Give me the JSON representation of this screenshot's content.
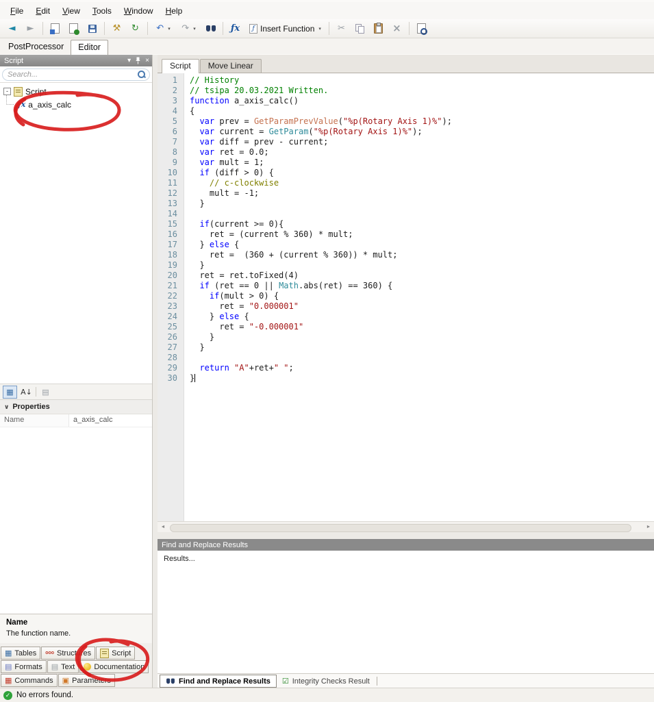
{
  "menu": {
    "items": [
      "File",
      "Edit",
      "View",
      "Tools",
      "Window",
      "Help"
    ]
  },
  "toolbar": {
    "insert_function_label": "Insert Function"
  },
  "workspace_tabs": {
    "postprocessor": "PostProcessor",
    "editor": "Editor"
  },
  "script_panel": {
    "title": "Script",
    "search_placeholder": "Search...",
    "tree": {
      "root_label": "Script",
      "child_label": "a_axis_calc"
    }
  },
  "properties_panel": {
    "header": "Properties",
    "name_label": "Name",
    "name_value": "a_axis_calc"
  },
  "description_box": {
    "title": "Name",
    "text": "The function name."
  },
  "left_tabs": {
    "tables": "Tables",
    "structures": "Structures",
    "script": "Script",
    "formats": "Formats",
    "text": "Text",
    "documentation": "Documentation",
    "commands": "Commands",
    "parameters": "Parameters"
  },
  "editor": {
    "tabs": [
      "Script",
      "Move Linear"
    ],
    "cursor_line": 30,
    "token_colors": {
      "k": "#0000ff",
      "c": "#008000",
      "o": "#808000",
      "s": "#a31515",
      "f": "#2e8b9a",
      "g": "#c4714f",
      "p": "#1c1c1c"
    },
    "code": [
      [
        [
          "c",
          "// History"
        ]
      ],
      [
        [
          "c",
          "// tsipa 20.03.2021 Written."
        ]
      ],
      [
        [
          "k",
          "function"
        ],
        [
          "p",
          " a_axis_calc()"
        ]
      ],
      [
        [
          "p",
          "{"
        ]
      ],
      [
        [
          "p",
          "  "
        ],
        [
          "k",
          "var"
        ],
        [
          "p",
          " prev = "
        ],
        [
          "g",
          "GetParamPrevValue"
        ],
        [
          "p",
          "("
        ],
        [
          "s",
          "\"%p(Rotary Axis 1)%\""
        ],
        [
          "p",
          ");"
        ]
      ],
      [
        [
          "p",
          "  "
        ],
        [
          "k",
          "var"
        ],
        [
          "p",
          " current = "
        ],
        [
          "f",
          "GetParam"
        ],
        [
          "p",
          "("
        ],
        [
          "s",
          "\"%p(Rotary Axis 1)%\""
        ],
        [
          "p",
          ");"
        ]
      ],
      [
        [
          "p",
          "  "
        ],
        [
          "k",
          "var"
        ],
        [
          "p",
          " diff = prev - current;"
        ]
      ],
      [
        [
          "p",
          "  "
        ],
        [
          "k",
          "var"
        ],
        [
          "p",
          " ret = 0.0;"
        ]
      ],
      [
        [
          "p",
          "  "
        ],
        [
          "k",
          "var"
        ],
        [
          "p",
          " mult = 1;"
        ]
      ],
      [
        [
          "p",
          "  "
        ],
        [
          "k",
          "if"
        ],
        [
          "p",
          " (diff > 0) {"
        ]
      ],
      [
        [
          "p",
          "    "
        ],
        [
          "o",
          "// c-clockwise"
        ]
      ],
      [
        [
          "p",
          "    mult = -1;"
        ]
      ],
      [
        [
          "p",
          "  }"
        ]
      ],
      [],
      [
        [
          "p",
          "  "
        ],
        [
          "k",
          "if"
        ],
        [
          "p",
          "(current >= 0){"
        ]
      ],
      [
        [
          "p",
          "    ret = (current % 360) * mult;"
        ]
      ],
      [
        [
          "p",
          "  } "
        ],
        [
          "k",
          "else"
        ],
        [
          "p",
          " {"
        ]
      ],
      [
        [
          "p",
          "    ret =  (360 + (current % 360)) * mult;"
        ]
      ],
      [
        [
          "p",
          "  }"
        ]
      ],
      [
        [
          "p",
          "  ret = ret.toFixed(4)"
        ]
      ],
      [
        [
          "p",
          "  "
        ],
        [
          "k",
          "if"
        ],
        [
          "p",
          " (ret == 0 || "
        ],
        [
          "f",
          "Math"
        ],
        [
          "p",
          ".abs(ret) == 360) {"
        ]
      ],
      [
        [
          "p",
          "    "
        ],
        [
          "k",
          "if"
        ],
        [
          "p",
          "(mult > 0) {"
        ]
      ],
      [
        [
          "p",
          "      ret = "
        ],
        [
          "s",
          "\"0.000001\""
        ]
      ],
      [
        [
          "p",
          "    } "
        ],
        [
          "k",
          "else"
        ],
        [
          "p",
          " {"
        ]
      ],
      [
        [
          "p",
          "      ret = "
        ],
        [
          "s",
          "\"-0.000001\""
        ]
      ],
      [
        [
          "p",
          "    }"
        ]
      ],
      [
        [
          "p",
          "  }"
        ]
      ],
      [],
      [
        [
          "p",
          "  "
        ],
        [
          "k",
          "return"
        ],
        [
          "p",
          " "
        ],
        [
          "s",
          "\"A\""
        ],
        [
          "p",
          "+ret+"
        ],
        [
          "s",
          "\" \""
        ],
        [
          "p",
          ";"
        ]
      ],
      [
        [
          "p",
          "}"
        ]
      ]
    ]
  },
  "results_panel": {
    "header": "Find and Replace Results",
    "placeholder": "Results...",
    "tabs": [
      "Find and Replace Results",
      "Integrity Checks Result"
    ]
  },
  "status_bar": {
    "message": "No errors found."
  },
  "icons": {
    "back": "◄",
    "forward": "►",
    "undo": "↶",
    "redo": "↷",
    "dropdown": "▾",
    "wrench": "⚒",
    "refresh": "↻",
    "scissors": "✂",
    "delete": "×",
    "fx": "ƒx",
    "grid": "▦",
    "doc_lines": "▤",
    "param": "▣",
    "ooo": "ooo",
    "check": "✓",
    "chevron": "∨",
    "sort": "A↓",
    "expander": "-",
    "integrity": "☑",
    "scroll_left": "◄",
    "scroll_right": "►"
  },
  "annotation_color": "#d81e1e"
}
